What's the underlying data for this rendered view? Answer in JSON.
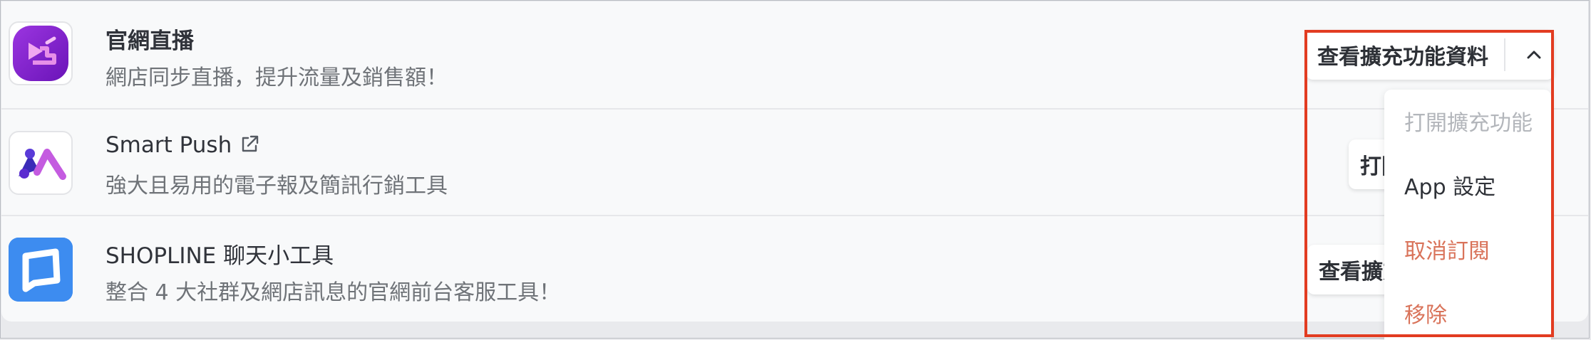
{
  "apps": [
    {
      "title": "官網直播",
      "description": "網店同步直播，提升流量及銷售額！",
      "logo_icon": "live-stream-icon",
      "action_label": "查看擴充功能資料",
      "action_toggle_icon": "chevron-up-icon"
    },
    {
      "title": "Smart Push",
      "title_icon": "external-link-icon",
      "description": "強大且易用的電子報及簡訊行銷工具",
      "logo_icon": "smart-push-logo",
      "action_label": "打開擴充功能"
    },
    {
      "title": "SHOPLINE 聊天小工具",
      "description": "整合 4 大社群及網店訊息的官網前台客服工具！",
      "logo_icon": "chat-tool-icon",
      "action_label": "查看擴充功能資料"
    }
  ],
  "dropdown_menu": {
    "items": [
      {
        "label": "打開擴充功能",
        "state": "disabled"
      },
      {
        "label": "App 設定",
        "state": "normal"
      },
      {
        "label": "取消訂閱",
        "state": "danger"
      },
      {
        "label": "移除",
        "state": "danger"
      }
    ]
  },
  "colors": {
    "danger": "#d9735a",
    "disabled": "#b3b6bb",
    "highlight_border": "#e23c21",
    "live_logo": "#7d21c9",
    "chat_logo": "#3d8cf0"
  }
}
